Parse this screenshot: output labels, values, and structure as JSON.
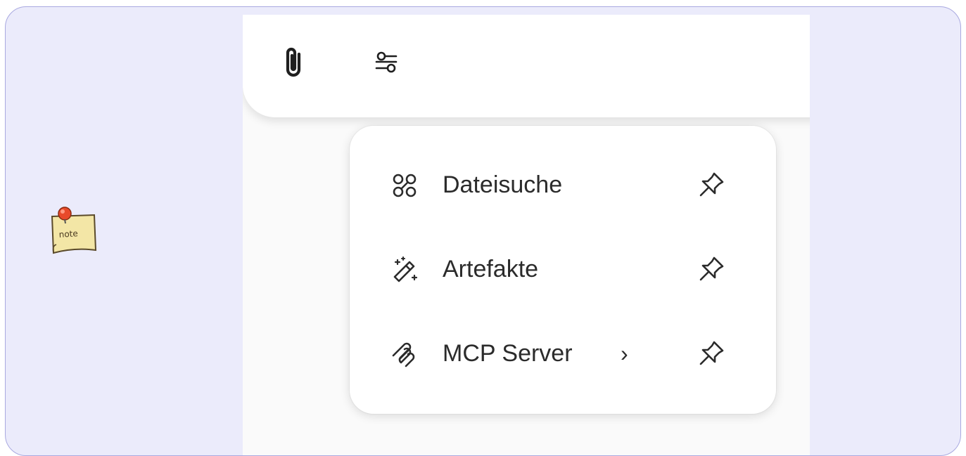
{
  "colors": {
    "frame_background": "#ebebfb",
    "frame_border": "#a9a9e0",
    "menu_background": "#ffffff",
    "text": "#2b2b2b"
  },
  "toolbar": {
    "attach_icon": "paperclip-icon",
    "tools_icon": "sliders-icon"
  },
  "menu": {
    "items": [
      {
        "label": "Dateisuche",
        "icon": "file-search-icon",
        "pin_icon": "pin-icon"
      },
      {
        "label": "Artefakte",
        "icon": "magic-wand-icon",
        "pin_icon": "pin-icon"
      },
      {
        "label": "MCP Server",
        "chevron": "›",
        "icon": "mcp-icon",
        "pin_icon": "pin-icon"
      }
    ]
  },
  "annotation": {
    "icon": "note-icon",
    "text": "note"
  }
}
